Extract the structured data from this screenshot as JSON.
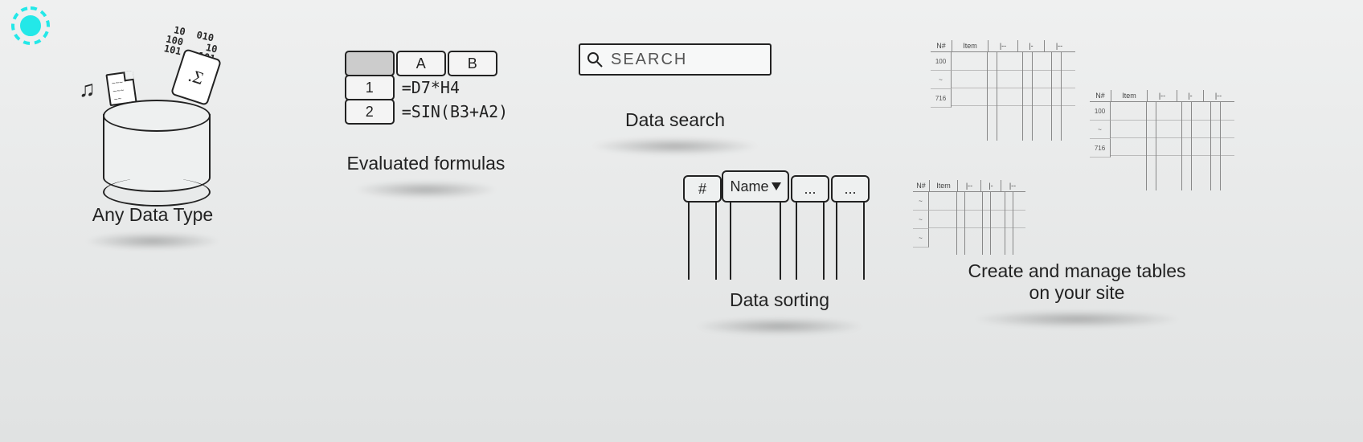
{
  "gear_color": "#23e8e8",
  "datatype": {
    "caption": "Any Data Type",
    "binary": [
      "10  010",
      "100    10",
      "101   101"
    ],
    "music_glyph": "♫",
    "doc_lines": [
      "~~~",
      "~~~",
      "~~"
    ],
    "sigma": ".Σ"
  },
  "formulas": {
    "caption": "Evaluated formulas",
    "headers": [
      "A",
      "B"
    ],
    "rows": [
      {
        "idx": "1",
        "formula": "=D7*H4"
      },
      {
        "idx": "2",
        "formula": "=SIN(B3+A2)"
      }
    ]
  },
  "search": {
    "caption": "Data search",
    "placeholder": "SEARCH"
  },
  "sorting": {
    "caption": "Data sorting",
    "columns": [
      "#",
      "Name",
      "...",
      "..."
    ]
  },
  "tables": {
    "caption_line1": "Create and manage tables",
    "caption_line2": "on your site",
    "header_cols": [
      "N#",
      "Item",
      "|--",
      "|-",
      "|--"
    ],
    "row_labels": [
      "100",
      "~",
      "716"
    ],
    "row_labels_small": [
      "~",
      "~",
      "~"
    ]
  }
}
